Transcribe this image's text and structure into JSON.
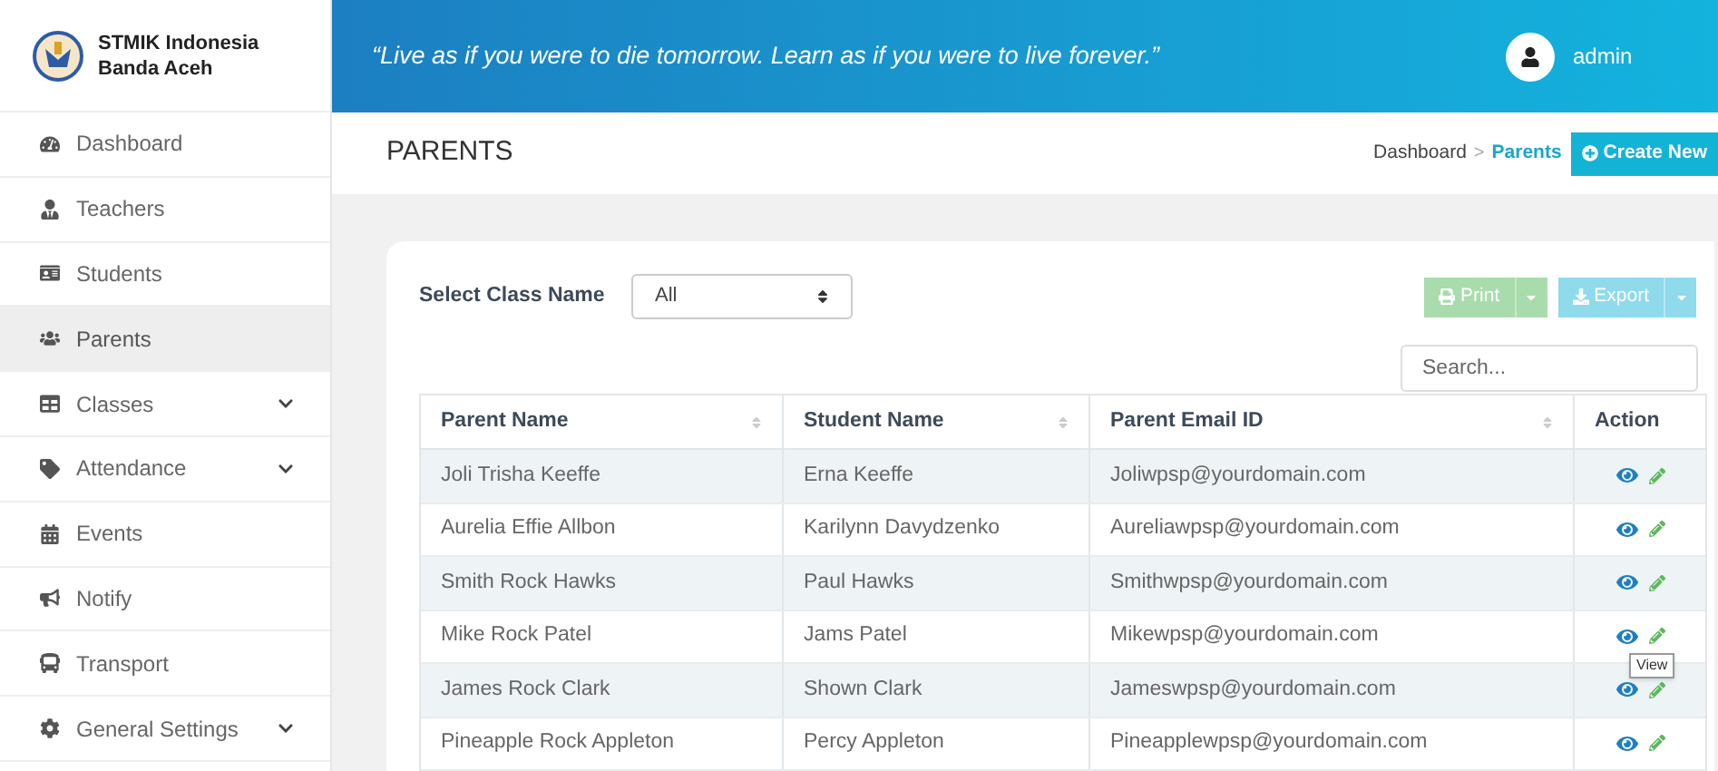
{
  "brand": {
    "name": "STMIK Indonesia Banda Aceh"
  },
  "sidebar": {
    "items": [
      {
        "label": "Dashboard",
        "selected": false,
        "expandable": false
      },
      {
        "label": "Teachers",
        "selected": false,
        "expandable": false
      },
      {
        "label": "Students",
        "selected": false,
        "expandable": false
      },
      {
        "label": "Parents",
        "selected": true,
        "expandable": false
      },
      {
        "label": "Classes",
        "selected": false,
        "expandable": true
      },
      {
        "label": "Attendance",
        "selected": false,
        "expandable": true
      },
      {
        "label": "Events",
        "selected": false,
        "expandable": false
      },
      {
        "label": "Notify",
        "selected": false,
        "expandable": false
      },
      {
        "label": "Transport",
        "selected": false,
        "expandable": false
      },
      {
        "label": "General Settings",
        "selected": false,
        "expandable": true
      }
    ]
  },
  "topbar": {
    "quote": "“Live as if you were to die tomorrow. Learn as if you were to live forever.”",
    "user": "admin"
  },
  "page_header": {
    "title": "PARENTS",
    "breadcrumb": [
      "Dashboard",
      "Parents"
    ],
    "separator": ">",
    "create_button": "Create New"
  },
  "filter": {
    "label": "Select Class Name",
    "value": "All"
  },
  "buttons": {
    "print": "Print",
    "export": "Export"
  },
  "search": {
    "placeholder": "Search..."
  },
  "table": {
    "columns": [
      {
        "label": "Parent Name",
        "sortable": true
      },
      {
        "label": "Student Name",
        "sortable": true
      },
      {
        "label": "Parent Email ID",
        "sortable": true
      },
      {
        "label": "Action",
        "sortable": false
      }
    ],
    "rows": [
      {
        "cells": [
          "Joli Trisha Keeffe",
          "Erna Keeffe",
          "Joliwpsp@yourdomain.com"
        ]
      },
      {
        "cells": [
          "Aurelia Effie Allbon",
          "Karilynn Davydzenko",
          "Aureliawpsp@yourdomain.com"
        ]
      },
      {
        "cells": [
          "Smith Rock Hawks",
          "Paul Hawks",
          "Smithwpsp@yourdomain.com"
        ]
      },
      {
        "cells": [
          "Mike Rock Patel",
          "Jams Patel",
          "Mikewpsp@yourdomain.com"
        ]
      },
      {
        "cells": [
          "James Rock Clark",
          "Shown Clark",
          "Jameswpsp@yourdomain.com"
        ],
        "tooltip": "View"
      },
      {
        "cells": [
          "Pineapple Rock Appleton",
          "Percy Appleton",
          "Pineapplewpsp@yourdomain.com"
        ]
      }
    ]
  }
}
